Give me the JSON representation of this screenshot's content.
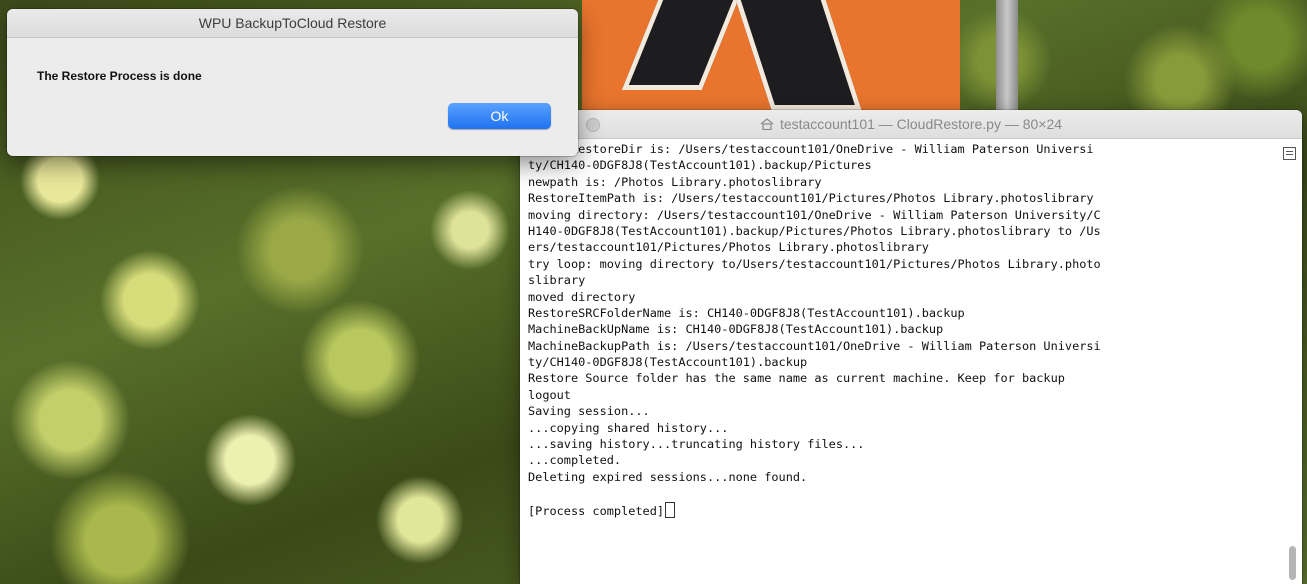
{
  "dialog": {
    "title": "WPU BackupToCloud Restore",
    "message": "The Restore Process is done",
    "ok_label": "Ok"
  },
  "terminal": {
    "title": "testaccount101 — CloudRestore.py — 80×24",
    "lines": [
      "    ntRestoreDir is: /Users/testaccount101/OneDrive - William Paterson Universi",
      "ty/CH140-0DGF8J8(TestAccount101).backup/Pictures",
      "newpath is: /Photos Library.photoslibrary",
      "RestoreItemPath is: /Users/testaccount101/Pictures/Photos Library.photoslibrary",
      "moving directory: /Users/testaccount101/OneDrive - William Paterson University/C",
      "H140-0DGF8J8(TestAccount101).backup/Pictures/Photos Library.photoslibrary to /Us",
      "ers/testaccount101/Pictures/Photos Library.photoslibrary",
      "try loop: moving directory to/Users/testaccount101/Pictures/Photos Library.photo",
      "slibrary",
      "moved directory",
      "RestoreSRCFolderName is: CH140-0DGF8J8(TestAccount101).backup",
      "MachineBackUpName is: CH140-0DGF8J8(TestAccount101).backup",
      "MachineBackupPath is: /Users/testaccount101/OneDrive - William Paterson Universi",
      "ty/CH140-0DGF8J8(TestAccount101).backup",
      "Restore Source folder has the same name as current machine. Keep for backup",
      "logout",
      "Saving session...",
      "...copying shared history...",
      "...saving history...truncating history files...",
      "...completed.",
      "Deleting expired sessions...none found.",
      "",
      "[Process completed]"
    ]
  },
  "icons": {
    "title_icon": "home-icon",
    "scroll_icon": "split-pane-icon"
  }
}
